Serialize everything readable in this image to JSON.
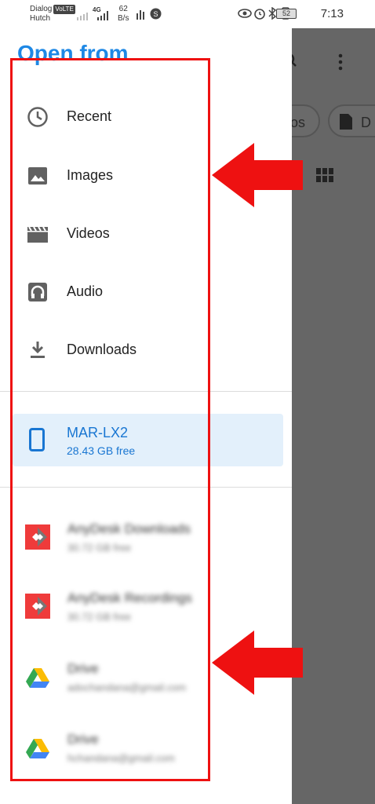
{
  "status_bar": {
    "carrier_1": "Dialog",
    "volte": "VoLTE",
    "carrier_2": "Hutch",
    "network": "4G",
    "speed_value": "62",
    "speed_unit": "B/s",
    "battery": "52",
    "time": "7:13"
  },
  "drawer": {
    "title": "Open from",
    "items": [
      {
        "label": "Recent",
        "icon": "clock-icon"
      },
      {
        "label": "Images",
        "icon": "image-icon"
      },
      {
        "label": "Videos",
        "icon": "video-icon"
      },
      {
        "label": "Audio",
        "icon": "headphones-icon"
      },
      {
        "label": "Downloads",
        "icon": "download-icon"
      }
    ],
    "device": {
      "name": "MAR-LX2",
      "free": "28.43 GB free",
      "icon": "phone-icon"
    },
    "roots": [
      {
        "name": "AnyDesk Downloads",
        "sub": "30.72 GB free",
        "icon": "anydesk-icon"
      },
      {
        "name": "AnyDesk Recordings",
        "sub": "30.72 GB free",
        "icon": "anydesk-icon"
      },
      {
        "name": "Drive",
        "sub": "adochandana@gmail.com",
        "icon": "google-drive-icon"
      },
      {
        "name": "Drive",
        "sub": "hchandana@gmail.com",
        "icon": "google-drive-icon"
      }
    ]
  },
  "background_app": {
    "chip_1": "os",
    "chip_2": "D",
    "icons": [
      "search-icon",
      "more-vert-icon",
      "grid-view-icon",
      "document-icon"
    ]
  },
  "colors": {
    "accent": "#1e88e5",
    "device_bg": "#e3f0fb",
    "annotation": "#ee1111",
    "scrim": "#666666"
  }
}
